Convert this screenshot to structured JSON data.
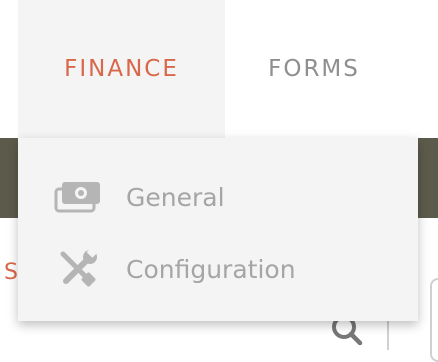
{
  "nav": {
    "items": [
      {
        "label": "FINANCE",
        "active": true
      },
      {
        "label": "FORMS",
        "active": false
      }
    ],
    "active_color": "#d9684a",
    "inactive_color": "#8f8f8f"
  },
  "dropdown": {
    "items": [
      {
        "label": "General",
        "icon": "money-icon"
      },
      {
        "label": "Configuration",
        "icon": "tools-icon"
      }
    ]
  },
  "background": {
    "peek_text": "S",
    "band_color": "#5c5b4b"
  }
}
